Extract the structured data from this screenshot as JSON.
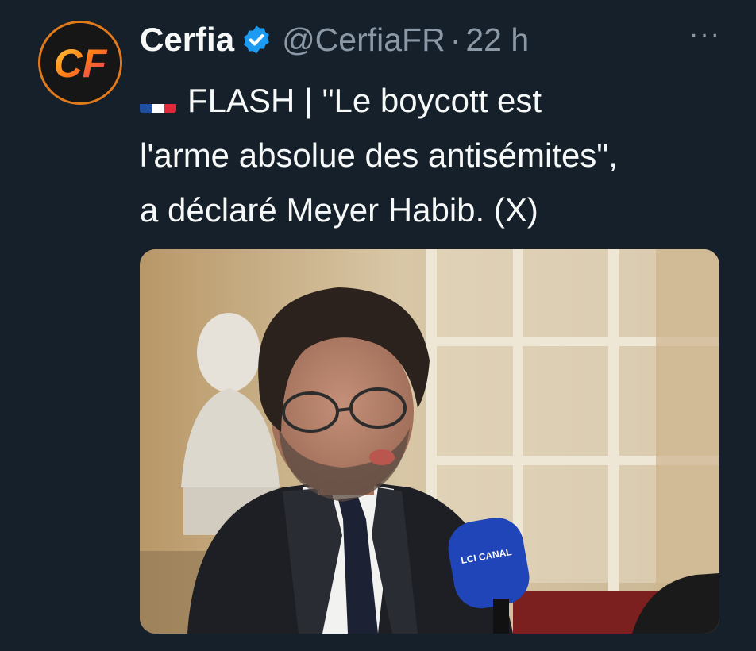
{
  "tweet": {
    "author_name": "Cerfia",
    "handle": "@CerfiaFR",
    "separator": "·",
    "timestamp": "22 h",
    "more_label": "···",
    "avatar_logo_text": "CF",
    "flag": "french-flag-emoji",
    "text_prefix": "FLASH | \"Le boycott est",
    "text_line2": "l'arme absolue des antisémites\",",
    "text_line3": "a déclaré Meyer Habib. (X)",
    "photo_mic_text": "LCI CANAL",
    "colors": {
      "background": "#15202b",
      "primary_text": "#f7f9f9",
      "secondary_text": "#8b98a5",
      "verified": "#1d9bf0"
    }
  }
}
